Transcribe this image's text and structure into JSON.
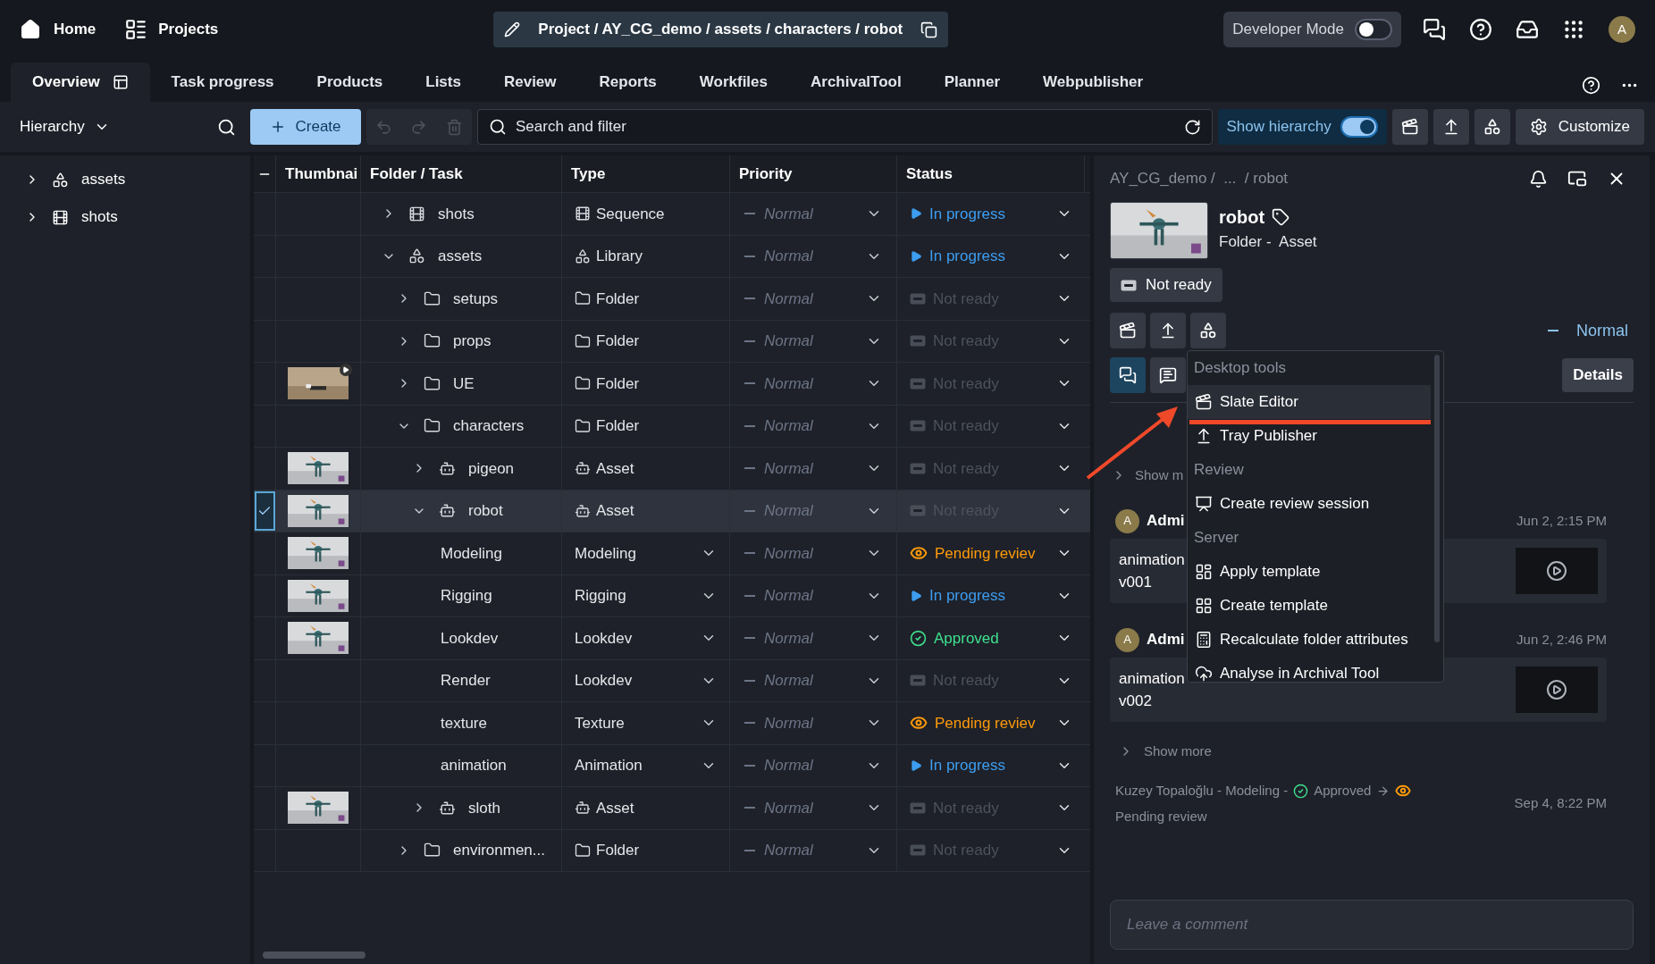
{
  "topbar": {
    "home": "Home",
    "projects": "Projects",
    "breadcrumb": "Project / AY_CG_demo / assets / characters / robot",
    "developer_mode": {
      "label": "Developer Mode",
      "on": false
    },
    "avatar": "A"
  },
  "tabs": [
    {
      "label": "Overview",
      "selected": true
    },
    {
      "label": "Task progress",
      "selected": false
    },
    {
      "label": "Products",
      "selected": false
    },
    {
      "label": "Lists",
      "selected": false
    },
    {
      "label": "Review",
      "selected": false
    },
    {
      "label": "Reports",
      "selected": false
    },
    {
      "label": "Workfiles",
      "selected": false
    },
    {
      "label": "ArchivalTool",
      "selected": false
    },
    {
      "label": "Planner",
      "selected": false
    },
    {
      "label": "Webpublisher",
      "selected": false
    }
  ],
  "toolbar": {
    "hierarchy": "Hierarchy",
    "create": "Create",
    "search": {
      "placeholder": "Search and filter"
    },
    "show_hierarchy": {
      "label": "Show hierarchy",
      "on": true
    },
    "customize": "Customize"
  },
  "sidebar": {
    "items": [
      {
        "label": "assets",
        "kind": "library",
        "expanded": false
      },
      {
        "label": "shots",
        "kind": "sequence",
        "expanded": false
      }
    ]
  },
  "table": {
    "columns": [
      "Thumbnai",
      "Folder / Task",
      "Type",
      "Priority",
      "Status"
    ],
    "rows": [
      {
        "name": "shots",
        "kind": "sequence",
        "type": "Sequence",
        "priority": "Normal",
        "status": {
          "label": "In progress",
          "kind": "in_progress"
        },
        "expanded": false,
        "selected": false
      },
      {
        "name": "assets",
        "kind": "library",
        "type": "Library",
        "priority": "Normal",
        "status": {
          "label": "In progress",
          "kind": "in_progress"
        },
        "expanded": true,
        "selected": false,
        "children": [
          {
            "name": "setups",
            "kind": "folder",
            "type": "Folder",
            "priority": "Normal",
            "status": {
              "label": "Not ready",
              "kind": "not_ready"
            },
            "expanded": false,
            "selected": false
          },
          {
            "name": "props",
            "kind": "folder",
            "type": "Folder",
            "priority": "Normal",
            "status": {
              "label": "Not ready",
              "kind": "not_ready"
            },
            "expanded": false,
            "selected": false
          },
          {
            "name": "UE",
            "kind": "folder",
            "type": "Folder",
            "priority": "Normal",
            "status": {
              "label": "Not ready",
              "kind": "not_ready"
            },
            "expanded": false,
            "selected": false,
            "thumbnail": {
              "kind": "video"
            }
          },
          {
            "name": "characters",
            "kind": "folder",
            "type": "Folder",
            "priority": "Normal",
            "status": {
              "label": "Not ready",
              "kind": "not_ready"
            },
            "expanded": true,
            "selected": false,
            "children": [
              {
                "name": "pigeon",
                "kind": "asset",
                "type": "Asset",
                "priority": "Normal",
                "status": {
                  "label": "Not ready",
                  "kind": "not_ready"
                },
                "expanded": false,
                "selected": false
              },
              {
                "name": "robot",
                "kind": "asset",
                "type": "Asset",
                "priority": "Normal",
                "status": {
                  "label": "Not ready",
                  "kind": "not_ready"
                },
                "expanded": true,
                "selected": true,
                "children": [
                  {
                    "name": "Modeling",
                    "kind": "task",
                    "type": "Modeling",
                    "priority": "Normal",
                    "status": {
                      "label": "Pending reviev",
                      "kind": "pending"
                    },
                    "selected": false
                  },
                  {
                    "name": "Rigging",
                    "kind": "task",
                    "type": "Rigging",
                    "priority": "Normal",
                    "status": {
                      "label": "In progress",
                      "kind": "in_progress"
                    },
                    "selected": false
                  },
                  {
                    "name": "Lookdev",
                    "kind": "task",
                    "type": "Lookdev",
                    "priority": "Normal",
                    "status": {
                      "label": "Approved",
                      "kind": "approved"
                    },
                    "selected": false
                  },
                  {
                    "name": "Render",
                    "kind": "task",
                    "type": "Lookdev",
                    "priority": "Normal",
                    "status": {
                      "label": "Not ready",
                      "kind": "not_ready"
                    },
                    "selected": false
                  },
                  {
                    "name": "texture",
                    "kind": "task",
                    "type": "Texture",
                    "priority": "Normal",
                    "status": {
                      "label": "Pending reviev",
                      "kind": "pending"
                    },
                    "selected": false
                  },
                  {
                    "name": "animation",
                    "kind": "task",
                    "type": "Animation",
                    "priority": "Normal",
                    "status": {
                      "label": "In progress",
                      "kind": "in_progress"
                    },
                    "selected": false
                  }
                ]
              },
              {
                "name": "sloth",
                "kind": "asset",
                "type": "Asset",
                "priority": "Normal",
                "status": {
                  "label": "Not ready",
                  "kind": "not_ready"
                },
                "expanded": false,
                "selected": false
              }
            ]
          },
          {
            "name": "environmen...",
            "kind": "folder",
            "type": "Folder",
            "priority": "Normal",
            "status": {
              "label": "Not ready",
              "kind": "not_ready"
            },
            "expanded": false,
            "selected": false
          }
        ]
      }
    ]
  },
  "details": {
    "breadcrumb": "AY_CG_demo /  ...  / robot",
    "title": "robot",
    "subtitle": "Folder -  Asset",
    "status": "Not ready",
    "priority": "Normal",
    "details_button": "Details",
    "feed_tabs": [
      {
        "kind": "comments",
        "selected": true
      },
      {
        "kind": "notes",
        "selected": false
      }
    ],
    "show_more_top": "Show m",
    "comments": [
      {
        "avatar": "A",
        "author": "Admi",
        "date": "Jun 2, 2:15 PM",
        "lines": [
          "animation",
          "v001"
        ]
      },
      {
        "avatar": "A",
        "author": "Admi",
        "date": "Jun 2, 2:46 PM",
        "lines": [
          "animation",
          "v002"
        ]
      }
    ],
    "show_more": "Show more",
    "activity": {
      "text": "Kuzey Topaloğlu - Modeling -",
      "from": "Approved",
      "to": "Pending review",
      "date": "Sep 4, 8:22 PM"
    },
    "comment_field": {
      "placeholder": "Leave a comment"
    }
  },
  "menu": {
    "sections": [
      {
        "title": "Desktop tools",
        "items": [
          {
            "label": "Slate Editor",
            "highlighted": true
          },
          {
            "label": "Tray Publisher",
            "highlighted": false
          }
        ]
      },
      {
        "title": "Review",
        "items": [
          {
            "label": "Create review session",
            "highlighted": false
          }
        ]
      },
      {
        "title": "Server",
        "items": [
          {
            "label": "Apply template",
            "highlighted": false
          },
          {
            "label": "Create template",
            "highlighted": false
          },
          {
            "label": "Recalculate folder attributes",
            "highlighted": false
          },
          {
            "label": "Analyse in Archival Tool",
            "highlighted": false
          }
        ]
      }
    ]
  }
}
